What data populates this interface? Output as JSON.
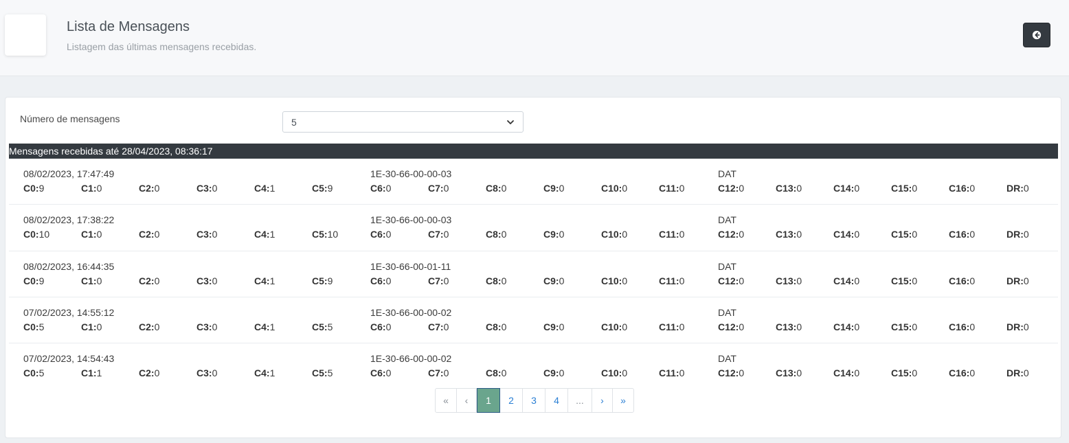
{
  "header": {
    "title": "Lista de Mensagens",
    "subtitle": "Listagem das últimas mensagens recebidas.",
    "back_icon": "arrow-circle-left-icon"
  },
  "filter": {
    "label": "Número de mensagens",
    "selected": "5"
  },
  "list": {
    "header": "Mensagens recebidas até 28/04/2023, 08:36:17"
  },
  "messages": [
    {
      "date": "08/02/2023, 17:47:49",
      "device": "1E-30-66-00-00-03",
      "type": "DAT",
      "fields": [
        {
          "k": "C0:",
          "v": "9"
        },
        {
          "k": "C1:",
          "v": "0"
        },
        {
          "k": "C2:",
          "v": "0"
        },
        {
          "k": "C3:",
          "v": "0"
        },
        {
          "k": "C4:",
          "v": "1"
        },
        {
          "k": "C5:",
          "v": "9"
        },
        {
          "k": "C6:",
          "v": "0"
        },
        {
          "k": "C7:",
          "v": "0"
        },
        {
          "k": "C8:",
          "v": "0"
        },
        {
          "k": "C9:",
          "v": "0"
        },
        {
          "k": "C10:",
          "v": "0"
        },
        {
          "k": "C11:",
          "v": "0"
        },
        {
          "k": "C12:",
          "v": "0"
        },
        {
          "k": "C13:",
          "v": "0"
        },
        {
          "k": "C14:",
          "v": "0"
        },
        {
          "k": "C15:",
          "v": "0"
        },
        {
          "k": "C16:",
          "v": "0"
        },
        {
          "k": "DR:",
          "v": "0"
        }
      ]
    },
    {
      "date": "08/02/2023, 17:38:22",
      "device": "1E-30-66-00-00-03",
      "type": "DAT",
      "fields": [
        {
          "k": "C0:",
          "v": "10"
        },
        {
          "k": "C1:",
          "v": "0"
        },
        {
          "k": "C2:",
          "v": "0"
        },
        {
          "k": "C3:",
          "v": "0"
        },
        {
          "k": "C4:",
          "v": "1"
        },
        {
          "k": "C5:",
          "v": "10"
        },
        {
          "k": "C6:",
          "v": "0"
        },
        {
          "k": "C7:",
          "v": "0"
        },
        {
          "k": "C8:",
          "v": "0"
        },
        {
          "k": "C9:",
          "v": "0"
        },
        {
          "k": "C10:",
          "v": "0"
        },
        {
          "k": "C11:",
          "v": "0"
        },
        {
          "k": "C12:",
          "v": "0"
        },
        {
          "k": "C13:",
          "v": "0"
        },
        {
          "k": "C14:",
          "v": "0"
        },
        {
          "k": "C15:",
          "v": "0"
        },
        {
          "k": "C16:",
          "v": "0"
        },
        {
          "k": "DR:",
          "v": "0"
        }
      ]
    },
    {
      "date": "08/02/2023, 16:44:35",
      "device": "1E-30-66-00-01-11",
      "type": "DAT",
      "fields": [
        {
          "k": "C0:",
          "v": "9"
        },
        {
          "k": "C1:",
          "v": "0"
        },
        {
          "k": "C2:",
          "v": "0"
        },
        {
          "k": "C3:",
          "v": "0"
        },
        {
          "k": "C4:",
          "v": "1"
        },
        {
          "k": "C5:",
          "v": "9"
        },
        {
          "k": "C6:",
          "v": "0"
        },
        {
          "k": "C7:",
          "v": "0"
        },
        {
          "k": "C8:",
          "v": "0"
        },
        {
          "k": "C9:",
          "v": "0"
        },
        {
          "k": "C10:",
          "v": "0"
        },
        {
          "k": "C11:",
          "v": "0"
        },
        {
          "k": "C12:",
          "v": "0"
        },
        {
          "k": "C13:",
          "v": "0"
        },
        {
          "k": "C14:",
          "v": "0"
        },
        {
          "k": "C15:",
          "v": "0"
        },
        {
          "k": "C16:",
          "v": "0"
        },
        {
          "k": "DR:",
          "v": "0"
        }
      ]
    },
    {
      "date": "07/02/2023, 14:55:12",
      "device": "1E-30-66-00-00-02",
      "type": "DAT",
      "fields": [
        {
          "k": "C0:",
          "v": "5"
        },
        {
          "k": "C1:",
          "v": "0"
        },
        {
          "k": "C2:",
          "v": "0"
        },
        {
          "k": "C3:",
          "v": "0"
        },
        {
          "k": "C4:",
          "v": "1"
        },
        {
          "k": "C5:",
          "v": "5"
        },
        {
          "k": "C6:",
          "v": "0"
        },
        {
          "k": "C7:",
          "v": "0"
        },
        {
          "k": "C8:",
          "v": "0"
        },
        {
          "k": "C9:",
          "v": "0"
        },
        {
          "k": "C10:",
          "v": "0"
        },
        {
          "k": "C11:",
          "v": "0"
        },
        {
          "k": "C12:",
          "v": "0"
        },
        {
          "k": "C13:",
          "v": "0"
        },
        {
          "k": "C14:",
          "v": "0"
        },
        {
          "k": "C15:",
          "v": "0"
        },
        {
          "k": "C16:",
          "v": "0"
        },
        {
          "k": "DR:",
          "v": "0"
        }
      ]
    },
    {
      "date": "07/02/2023, 14:54:43",
      "device": "1E-30-66-00-00-02",
      "type": "DAT",
      "fields": [
        {
          "k": "C0:",
          "v": "5"
        },
        {
          "k": "C1:",
          "v": "1"
        },
        {
          "k": "C2:",
          "v": "0"
        },
        {
          "k": "C3:",
          "v": "0"
        },
        {
          "k": "C4:",
          "v": "1"
        },
        {
          "k": "C5:",
          "v": "5"
        },
        {
          "k": "C6:",
          "v": "0"
        },
        {
          "k": "C7:",
          "v": "0"
        },
        {
          "k": "C8:",
          "v": "0"
        },
        {
          "k": "C9:",
          "v": "0"
        },
        {
          "k": "C10:",
          "v": "0"
        },
        {
          "k": "C11:",
          "v": "0"
        },
        {
          "k": "C12:",
          "v": "0"
        },
        {
          "k": "C13:",
          "v": "0"
        },
        {
          "k": "C14:",
          "v": "0"
        },
        {
          "k": "C15:",
          "v": "0"
        },
        {
          "k": "C16:",
          "v": "0"
        },
        {
          "k": "DR:",
          "v": "0"
        }
      ]
    }
  ],
  "pagination": {
    "first": "«",
    "prev": "‹",
    "pages": [
      "1",
      "2",
      "3",
      "4"
    ],
    "ellipsis": "...",
    "next": "›",
    "last": "»",
    "active": "1"
  },
  "colors": {
    "dark": "#343a40",
    "active_page": "#6aa58d",
    "link": "#2a7fd4"
  }
}
